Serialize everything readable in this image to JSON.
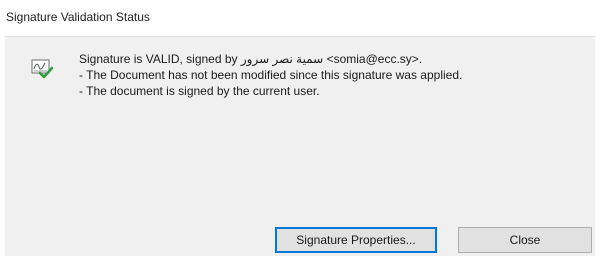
{
  "dialog": {
    "title": "Signature Validation Status",
    "message": {
      "line1": "Signature is VALID, signed by سمية نصر سرور <somia@ecc.sy>.",
      "line2": "- The Document has not been modified since this signature was applied.",
      "line3": "- The document is signed by the current user."
    },
    "icon": "signature-valid-icon",
    "buttons": {
      "properties_label": "Signature Properties...",
      "close_label": "Close"
    }
  }
}
